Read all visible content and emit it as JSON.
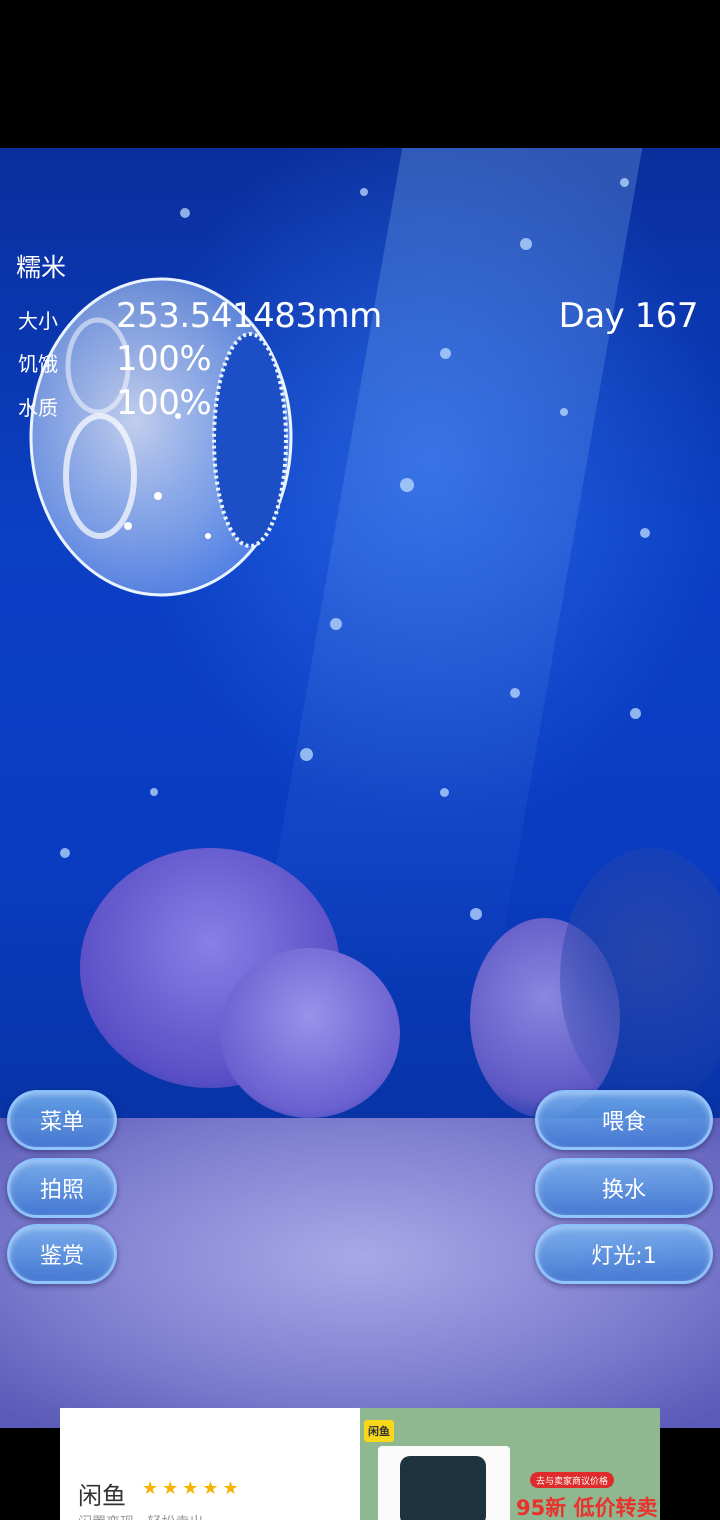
{
  "pet": {
    "name": "糯米"
  },
  "stats": [
    {
      "label": "大小",
      "value": "253.541483mm"
    },
    {
      "label": "饥饿",
      "value": "100%"
    },
    {
      "label": "水质",
      "value": "100%"
    }
  ],
  "day": "Day 167",
  "left_buttons": [
    {
      "label": "菜单"
    },
    {
      "label": "拍照"
    },
    {
      "label": "鉴赏"
    }
  ],
  "right_buttons": [
    {
      "label": "喂食"
    },
    {
      "label": "换水"
    },
    {
      "label": "灯光:1"
    }
  ],
  "ad": {
    "brand": "闲鱼",
    "stars": "★★★★★",
    "subtitle": "闲置变现 · 轻松卖出",
    "logo": "闲鱼",
    "tag": "去与卖家商议价格",
    "headline": "95新 低价转卖"
  },
  "colors": {
    "water_top": "#0a2f9c",
    "water_mid": "#0b3fc4",
    "button_fill": "#5a9ee0",
    "button_border": "#96c8ff",
    "ad_green": "#8fb890",
    "ad_headline": "#e8322b"
  }
}
